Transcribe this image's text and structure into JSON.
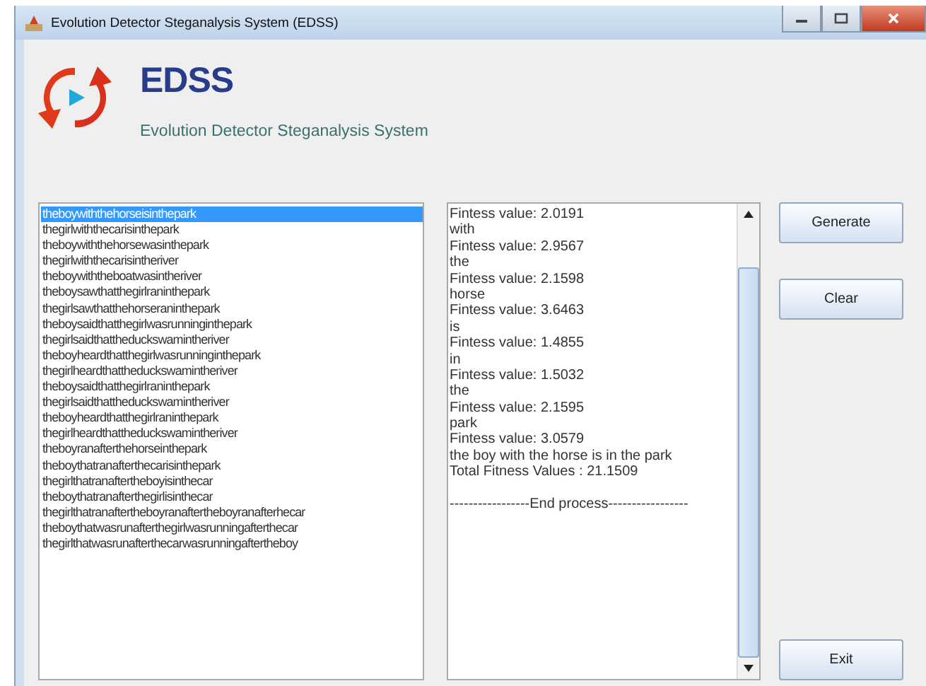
{
  "window": {
    "title": "Evolution Detector Steganalysis System (EDSS)"
  },
  "header": {
    "logo_text": "EDSS",
    "subtitle": "Evolution Detector Steganalysis System"
  },
  "sentence_list": [
    {
      "text": "theboywiththehorseisinthepark",
      "selected": true
    },
    {
      "text": "thegirlwiththecarisinthepark",
      "selected": false
    },
    {
      "text": "theboywiththehorsewasinthepark",
      "selected": false
    },
    {
      "text": "thegirlwiththecarisintheriver",
      "selected": false
    },
    {
      "text": "theboywiththeboatwasintheriver",
      "selected": false
    },
    {
      "text": "theboysawthatthegirlraninthepark",
      "selected": false
    },
    {
      "text": "thegirlsawthatthehorseraninthepark",
      "selected": false
    },
    {
      "text": "theboysaidthatthegirlwasrunninginthepark",
      "selected": false
    },
    {
      "text": "thegirlsaidthattheduckswamintheriver",
      "selected": false
    },
    {
      "text": "theboyheardthatthegirlwasrunninginthepark",
      "selected": false
    },
    {
      "text": "thegirlheardthattheduckswamintheriver",
      "selected": false
    },
    {
      "text": "theboysaidthatthegirlraninthepark",
      "selected": false
    },
    {
      "text": "thegirlsaidthattheduckswamintheriver",
      "selected": false
    },
    {
      "text": "theboyheardthatthegirlraninthepark",
      "selected": false
    },
    {
      "text": "thegirlheardthattheduckswamintheriver",
      "selected": false
    },
    {
      "text": "theboyranafterthehorseinthepark",
      "selected": false
    },
    {
      "text": "theboythatranafterthecarisinthepark",
      "selected": false
    },
    {
      "text": "thegirlthatranaftertheboyisinthecar",
      "selected": false
    },
    {
      "text": "theboythatranafterthegirlisinthecar",
      "selected": false
    },
    {
      "text": "thegirlthatranaftertheboyranaftertheboyranafterhecar",
      "selected": false
    },
    {
      "text": "theboythatwasrunafterthegirlwasrunningafterthecar",
      "selected": false
    },
    {
      "text": "thegirlthatwasrunafterthecarwasrunningaftertheboy",
      "selected": false
    }
  ],
  "output_lines": [
    "Fintess value: 2.0191",
    "with",
    "Fintess value: 2.9567",
    "the",
    "Fintess value: 2.1598",
    "horse",
    "Fintess value: 3.6463",
    "is",
    "Fintess value: 1.4855",
    "in",
    "Fintess value: 1.5032",
    "the",
    "Fintess value: 2.1595",
    "park",
    "Fintess value: 3.0579",
    "the boy with the horse is in the park",
    "Total Fitness Values : 21.1509"
  ],
  "end_marker": "-----------------End process-----------------",
  "buttons": {
    "generate": "Generate",
    "clear": "Clear",
    "exit": "Exit"
  }
}
